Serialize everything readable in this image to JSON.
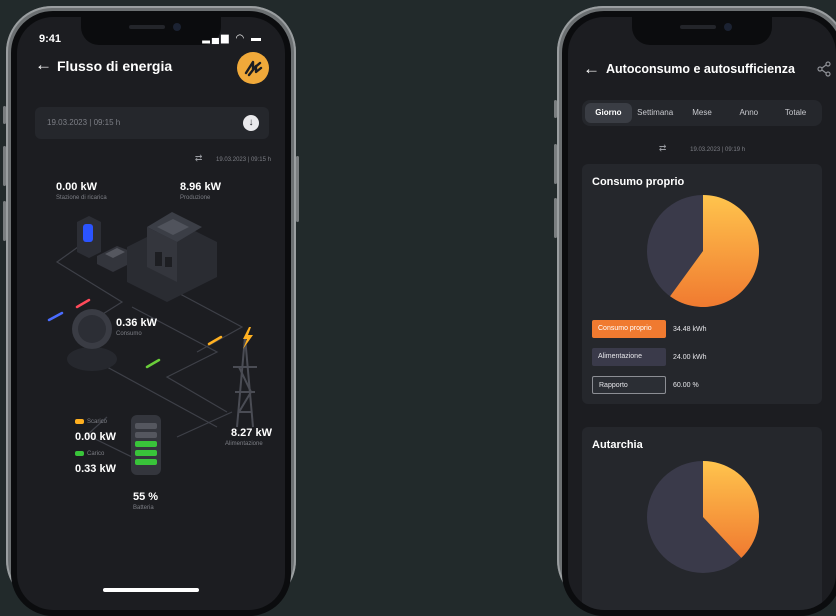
{
  "left": {
    "status_time": "9:41",
    "title": "Flusso di energia",
    "date_field": "19.03.2023 | 09:15 h",
    "sync_time": "19.03.2023 | 09:15 h",
    "nodes": {
      "stazione": {
        "value": "0.00 kW",
        "label": "Stazione di ricarica"
      },
      "produzione": {
        "value": "8.96 kW",
        "label": "Produzione"
      },
      "consumo": {
        "value": "0.36 kW",
        "label": "Consumo"
      },
      "alimentazione": {
        "value": "8.27 kW",
        "label": "Alimentazione"
      },
      "scarico": {
        "value": "0.00 kW",
        "label": "Scarico"
      },
      "carico": {
        "value": "0.33 kW",
        "label": "Carico"
      },
      "batteria": {
        "value": "55 %",
        "label": "Batteria"
      }
    }
  },
  "right": {
    "title": "Autoconsumo e autosufficienza",
    "tabs": [
      "Giorno",
      "Settimana",
      "Mese",
      "Anno",
      "Totale"
    ],
    "active_tab": "Giorno",
    "sync_time": "19.03.2023 | 09:19 h",
    "card1": {
      "title": "Consumo proprio",
      "pie_fraction": 0.6,
      "legend": [
        {
          "label": "Consumo proprio",
          "value": "34.48 kWh"
        },
        {
          "label": "Alimentazione",
          "value": "24.00 kWh"
        },
        {
          "label": "Rapporto",
          "value": "60.00 %"
        }
      ]
    },
    "card2": {
      "title": "Autarchia",
      "pie_fraction": 0.38
    }
  },
  "colors": {
    "background": "#222a2b",
    "screen": "#1c1d21",
    "card": "#25272c",
    "accent_orange": "#f07a30",
    "accent_yellow": "#ffc44d",
    "pie_dark": "#3a3a4a"
  }
}
